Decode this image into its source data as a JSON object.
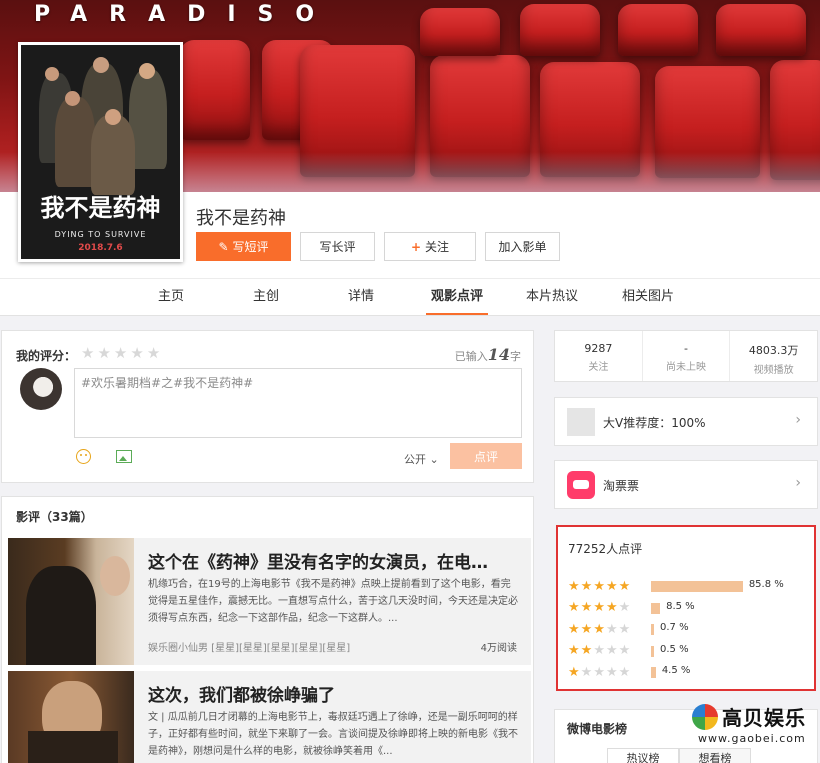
{
  "banner": {
    "title": "PARADISO"
  },
  "poster": {
    "caption": "我不是药神",
    "subtitle": "DYING TO SURVIVE",
    "date": "2018.7.6"
  },
  "movie": {
    "title": "我不是药神",
    "actions": {
      "short_review": "写短评",
      "long_review": "写长评",
      "follow": "关注",
      "add_library": "加入影单"
    }
  },
  "nav": {
    "tabs": [
      "主页",
      "主创",
      "详情",
      "观影点评",
      "本片热议",
      "相关图片"
    ],
    "active": "观影点评"
  },
  "my_rating": {
    "label": "我的评分：",
    "counter_prefix": "已输入",
    "counter_value": "14",
    "counter_suffix": "字",
    "text": "#欢乐暑期档#之#我不是药神#",
    "visibility": "公开",
    "submit": "点评"
  },
  "reviews": {
    "header": "影评（33篇）",
    "items": [
      {
        "title": "这个在《药神》里没有名字的女演员，在电…",
        "body": "机缘巧合，在19号的上海电影节《我不是药神》点映上提前看到了这个电影，看完觉得是五星佳作，震撼无比。一直想写点什么，苦于这几天没时间，今天还是决定必须得写点东西，纪念一下这部作品，纪念一下这群人。...",
        "author": "娱乐圈小仙男 [星星][星星][星星][星星][星星]",
        "reads": "4万阅读"
      },
      {
        "title": "这次，我们都被徐峥骗了",
        "body": "文 | 瓜瓜前几日才闭幕的上海电影节上，毒叔廷巧遇上了徐峥，还是一副乐呵呵的样子，正好都有些时间，就坐下来聊了一会。言谈间提及徐峥即将上映的新电影《我不是药神》，刚想问是什么样的电影，就被徐峥笑着用《...",
        "author": "",
        "reads": ""
      }
    ]
  },
  "stats": [
    {
      "value": "9287",
      "label": "关注"
    },
    {
      "value": "-",
      "label": "尚未上映"
    },
    {
      "value": "4803.3万",
      "label": "视频播放"
    }
  ],
  "recommend": {
    "text": "大V推荐度：100%"
  },
  "ticket": {
    "text": "淘票票"
  },
  "score": {
    "header": "77252人点评",
    "rows": [
      {
        "stars": 5,
        "pct": 85.8,
        "label": "85.8 %"
      },
      {
        "stars": 4,
        "pct": 8.5,
        "label": "8.5 %"
      },
      {
        "stars": 3,
        "pct": 0.7,
        "label": "0.7 %"
      },
      {
        "stars": 2,
        "pct": 0.5,
        "label": "0.5 %"
      },
      {
        "stars": 1,
        "pct": 4.5,
        "label": "4.5 %"
      }
    ],
    "star_color": "#f5a623",
    "star_empty_color": "#d6d6d6"
  },
  "weibo": {
    "title": "微博电影榜",
    "tabs": [
      "热议榜",
      "想看榜"
    ]
  },
  "watermark": {
    "name": "高贝娱乐",
    "url": "www.gaobei.com"
  },
  "colors": {
    "accent": "#f96d2b",
    "highlight_border": "#e03333",
    "bar": "#f3c297"
  }
}
